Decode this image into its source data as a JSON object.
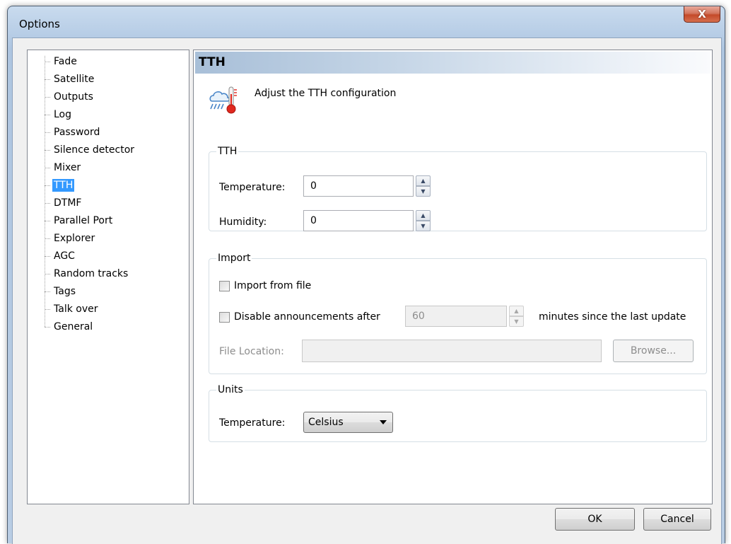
{
  "window": {
    "title": "Options",
    "close_label": "X"
  },
  "tree": {
    "items": [
      {
        "label": "Fade"
      },
      {
        "label": "Satellite"
      },
      {
        "label": "Outputs"
      },
      {
        "label": "Log"
      },
      {
        "label": "Password"
      },
      {
        "label": "Silence detector"
      },
      {
        "label": "Mixer"
      },
      {
        "label": "TTH",
        "selected": true
      },
      {
        "label": "DTMF"
      },
      {
        "label": "Parallel Port"
      },
      {
        "label": "Explorer"
      },
      {
        "label": "AGC"
      },
      {
        "label": "Random tracks"
      },
      {
        "label": "Tags"
      },
      {
        "label": "Talk over"
      },
      {
        "label": "General"
      }
    ]
  },
  "panel": {
    "title": "TTH",
    "icon": "weather-temperature-icon",
    "description": "Adjust the TTH configuration"
  },
  "tth_group": {
    "legend": "TTH",
    "temperature_label": "Temperature:",
    "temperature_value": "0",
    "humidity_label": "Humidity:",
    "humidity_value": "0"
  },
  "import_group": {
    "legend": "Import",
    "import_from_file_label": "Import from file",
    "import_from_file_checked": false,
    "disable_announcements_label": "Disable announcements after",
    "disable_announcements_checked": false,
    "minutes_value": "60",
    "minutes_suffix": "minutes since the last update",
    "file_location_label": "File Location:",
    "file_location_value": "",
    "browse_label": "Browse..."
  },
  "units_group": {
    "legend": "Units",
    "temperature_label": "Temperature:",
    "temperature_unit": "Celsius"
  },
  "footer": {
    "ok_label": "OK",
    "cancel_label": "Cancel"
  },
  "colors": {
    "selection": "#3399ff",
    "close_button": "#c44a2a"
  }
}
